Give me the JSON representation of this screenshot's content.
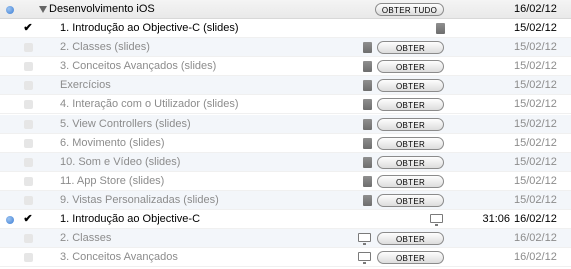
{
  "header": {
    "title": "Desenvolvimento iOS",
    "get_all_label": "OBTER TUDO",
    "date": "16/02/12"
  },
  "button_label": "OBTER",
  "rows": [
    {
      "title": "1. Introdução ao Objective-C (slides)",
      "date": "15/02/12",
      "checked": true,
      "muted": false,
      "icon": "document-icon",
      "button": false
    },
    {
      "title": "2. Classes (slides)",
      "date": "15/02/12",
      "checked": false,
      "muted": true,
      "icon": "document-icon",
      "button": true
    },
    {
      "title": "3. Conceitos Avançados (slides)",
      "date": "15/02/12",
      "checked": false,
      "muted": true,
      "icon": "document-icon",
      "button": true
    },
    {
      "title": "Exercícios",
      "date": "15/02/12",
      "checked": false,
      "muted": true,
      "icon": "document-icon",
      "button": true
    },
    {
      "title": "4. Interação com o Utilizador (slides)",
      "date": "15/02/12",
      "checked": false,
      "muted": true,
      "icon": "document-icon",
      "button": true
    },
    {
      "title": "5. View Controllers (slides)",
      "date": "15/02/12",
      "checked": false,
      "muted": true,
      "icon": "document-icon",
      "button": true
    },
    {
      "title": "6. Movimento (slides)",
      "date": "15/02/12",
      "checked": false,
      "muted": true,
      "icon": "document-icon",
      "button": true
    },
    {
      "title": "10. Som e Vídeo (slides)",
      "date": "15/02/12",
      "checked": false,
      "muted": true,
      "icon": "document-icon",
      "button": true
    },
    {
      "title": "11. App Store (slides)",
      "date": "15/02/12",
      "checked": false,
      "muted": true,
      "icon": "document-icon",
      "button": true
    },
    {
      "title": "9. Vistas Personalizadas (slides)",
      "date": "15/02/12",
      "checked": false,
      "muted": true,
      "icon": "document-icon",
      "button": true
    },
    {
      "title": "1. Introdução ao Objective-C",
      "date": "16/02/12",
      "checked": true,
      "muted": false,
      "icon": "monitor-icon",
      "button": false,
      "duration": "31:06",
      "unplayed": true
    },
    {
      "title": "2. Classes",
      "date": "16/02/12",
      "checked": false,
      "muted": true,
      "icon": "monitor-icon",
      "button": true
    },
    {
      "title": "3. Conceitos Avançados",
      "date": "16/02/12",
      "checked": false,
      "muted": true,
      "icon": "monitor-icon",
      "button": true
    }
  ]
}
